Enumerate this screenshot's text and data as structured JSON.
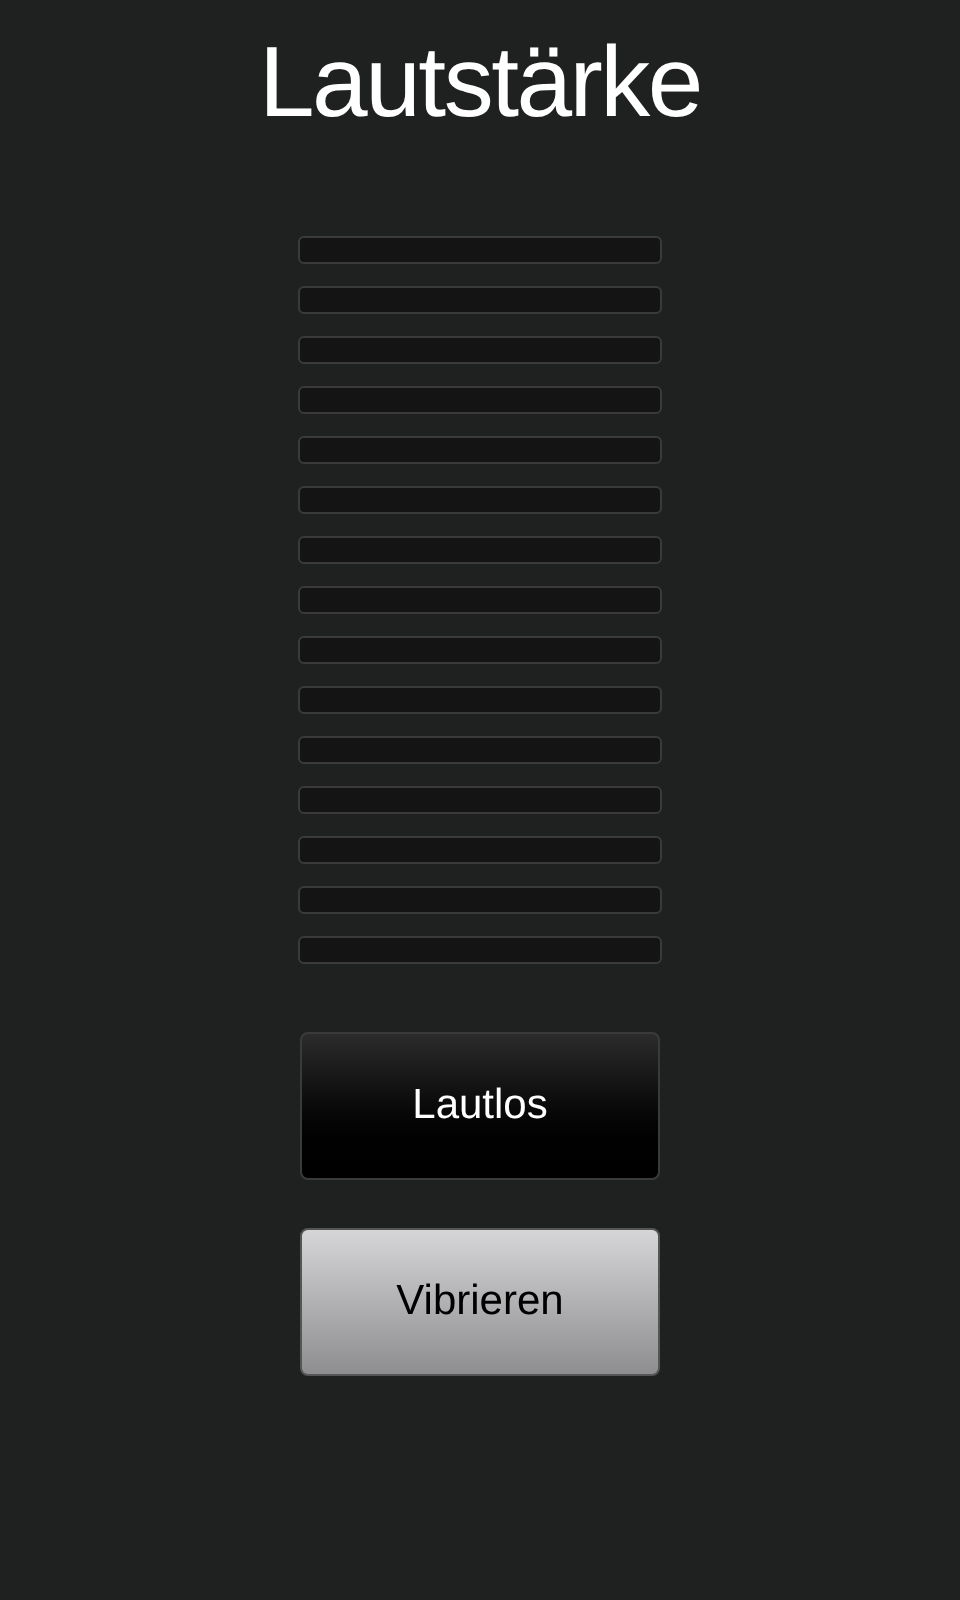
{
  "title": "Lautstärke",
  "volume_segments": [
    {
      "on": false
    },
    {
      "on": false
    },
    {
      "on": false
    },
    {
      "on": false
    },
    {
      "on": false
    },
    {
      "on": false
    },
    {
      "on": false
    },
    {
      "on": false
    },
    {
      "on": false
    },
    {
      "on": false
    },
    {
      "on": false
    },
    {
      "on": false
    },
    {
      "on": false
    },
    {
      "on": false
    },
    {
      "on": false
    }
  ],
  "buttons": [
    {
      "label": "Lautlos",
      "selected": false
    },
    {
      "label": "Vibrieren",
      "selected": true
    }
  ]
}
